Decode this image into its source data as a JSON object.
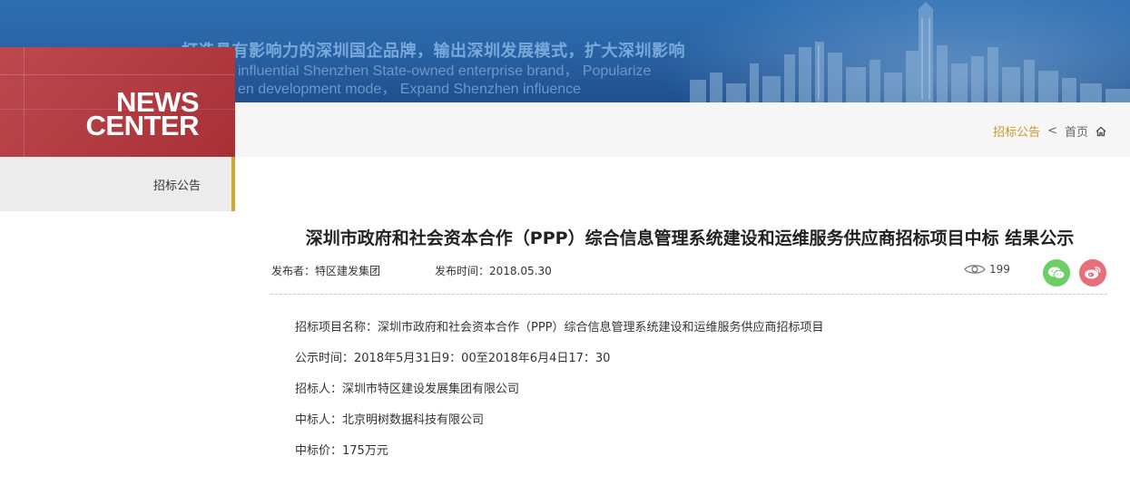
{
  "banner": {
    "slogan_cn": "打造具有影响力的深圳国企品牌，输出深圳发展模式，扩大深圳影响",
    "slogan_en_1": "influential Shenzhen State-owned enterprise brand， Popularize",
    "slogan_en_2": "en development mode， Expand Shenzhen influence"
  },
  "news_center": {
    "line1": "NEWS",
    "line2": "CENTER"
  },
  "breadcrumb": {
    "current": "招标公告",
    "separator": "<",
    "home": "首页",
    "home_icon": "home-icon"
  },
  "sidebar": {
    "items": [
      {
        "label": "招标公告",
        "active": true
      }
    ]
  },
  "article": {
    "title": "深圳市政府和社会资本合作（PPP）综合信息管理系统建设和运维服务供应商招标项目中标 结果公示",
    "publisher": "发布者：特区建发集团",
    "publish_time": "发布时间：2018.05.30",
    "views": "199",
    "share_icons": [
      "wechat-icon",
      "weibo-icon"
    ],
    "lines": [
      "招标项目名称：深圳市政府和社会资本合作（PPP）综合信息管理系统建设和运维服务供应商招标项目",
      "公示时间：2018年5月31日9：00至2018年6月4日17：30",
      "招标人：深圳市特区建设发展集团有限公司",
      "中标人：北京明树数据科技有限公司",
      "中标价：175万元"
    ]
  },
  "colors": {
    "brand_red": "#b5343a",
    "accent_gold": "#d0a62e",
    "wechat": "#6ccf66",
    "weibo": "#e86e79"
  }
}
